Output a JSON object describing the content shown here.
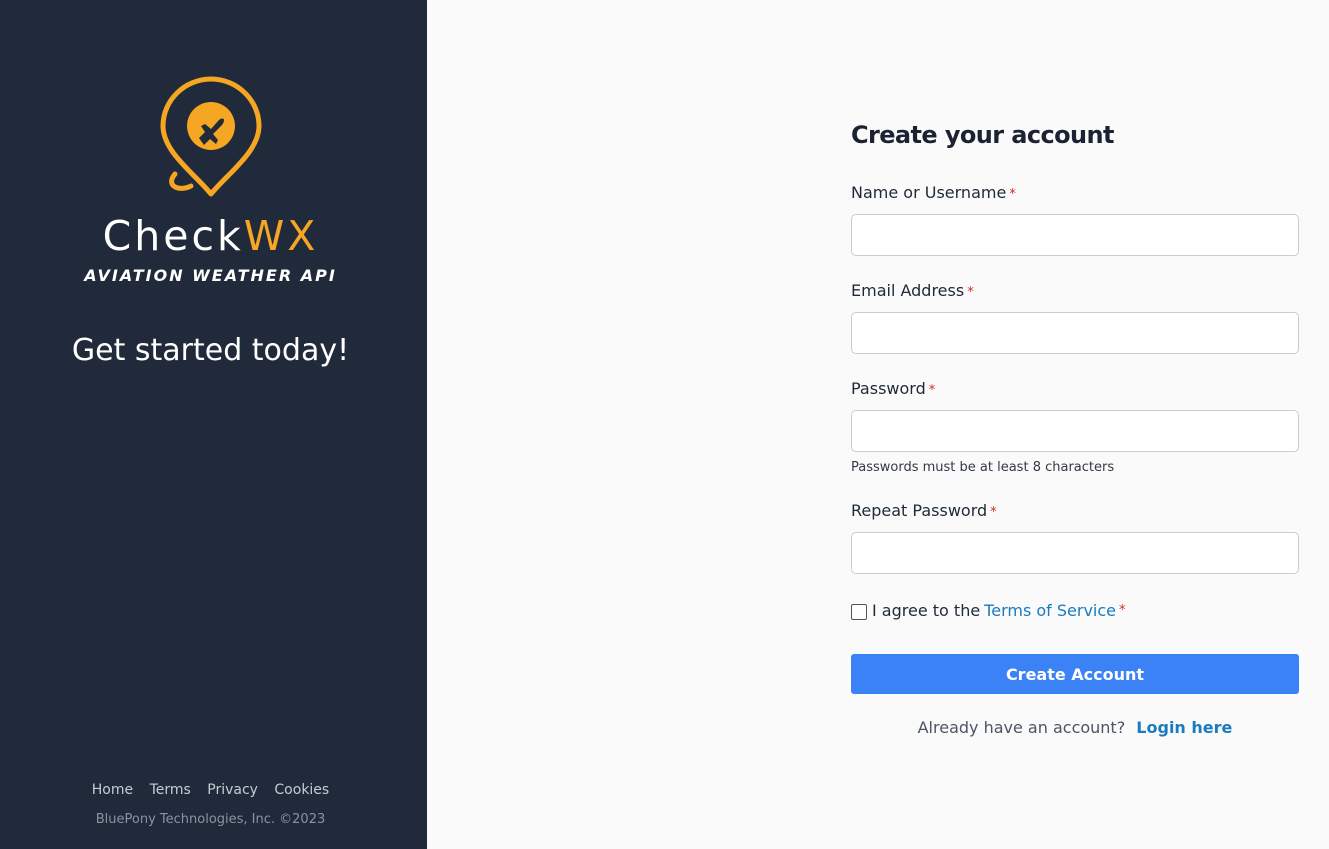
{
  "sidebar": {
    "brand_main": "Check",
    "brand_accent": "WX",
    "tagline": "AVIATION WEATHER API",
    "headline": "Get started today!",
    "footer_links": [
      "Home",
      "Terms",
      "Privacy",
      "Cookies"
    ],
    "copyright": "BluePony Technologies, Inc. ©2023",
    "logo_icon": "location-pin-airplane-icon"
  },
  "form": {
    "title": "Create your account",
    "required_mark": "*",
    "fields": [
      {
        "label": "Name or Username",
        "value": "",
        "placeholder": ""
      },
      {
        "label": "Email Address",
        "value": "",
        "placeholder": ""
      },
      {
        "label": "Password",
        "value": "",
        "placeholder": "",
        "hint": "Passwords must be at least 8 characters"
      },
      {
        "label": "Repeat Password",
        "value": "",
        "placeholder": ""
      }
    ],
    "agree_prefix": "I agree to the",
    "agree_link": "Terms of Service",
    "agree_checked": false,
    "submit_label": "Create Account",
    "login_prompt": "Already have an account?",
    "login_link": "Login here"
  },
  "colors": {
    "sidebar_bg": "#202a3a",
    "accent": "#f5a623",
    "primary_button": "#3b82f6",
    "link": "#1a7bbf",
    "required": "#d12a2a"
  }
}
